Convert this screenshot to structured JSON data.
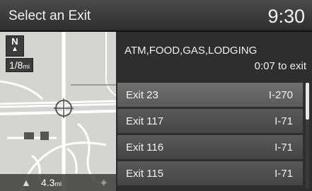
{
  "header": {
    "title": "Select an Exit",
    "clock": "9:30"
  },
  "map": {
    "north_label": "N",
    "north_icon": "north-arrow-icon",
    "scale_value": "1/8",
    "scale_unit": "mi",
    "distance_value": "4.3",
    "distance_unit": "mi"
  },
  "info": {
    "category": "ATM,FOOD,GAS,LODGING",
    "time_to_exit": "0:07 to exit"
  },
  "exits": [
    {
      "exit": "Exit 23",
      "road": "I-270",
      "selected": true
    },
    {
      "exit": "Exit 117",
      "road": "I-71",
      "selected": false
    },
    {
      "exit": "Exit 116",
      "road": "I-71",
      "selected": false
    },
    {
      "exit": "Exit 115",
      "road": "I-71",
      "selected": false
    }
  ],
  "colors": {
    "background": "#2e2e2e",
    "row": "#4f4f4f",
    "row_selected": "#666666",
    "map": "#d4d4d2",
    "text": "#f2f2f2"
  }
}
